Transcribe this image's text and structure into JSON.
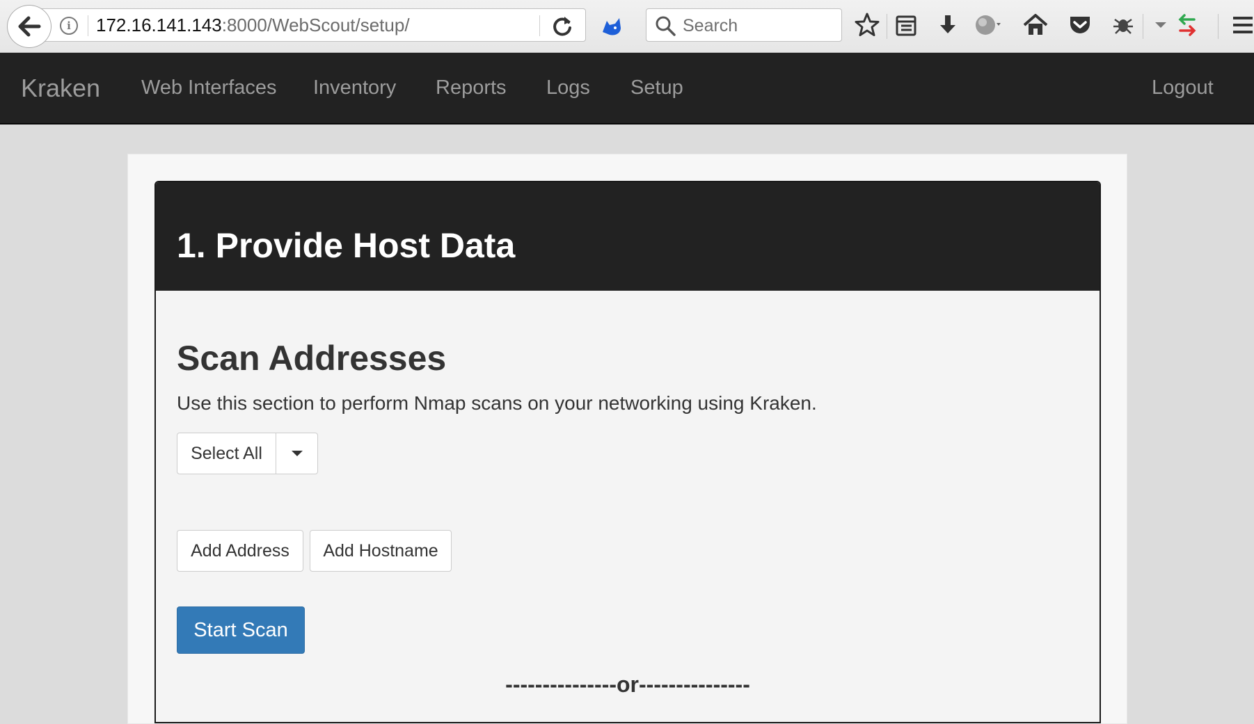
{
  "browser": {
    "url_host": "172.16.141.143",
    "url_path": ":8000/WebScout/setup/",
    "search_placeholder": "Search",
    "info_glyph": "i",
    "icons": [
      "back-arrow-icon",
      "info-icon",
      "reload-icon",
      "cat-extension-icon",
      "search-icon",
      "star-icon",
      "reading-list-icon",
      "download-icon",
      "globe-icon",
      "home-icon",
      "pocket-icon",
      "bug-extension-icon",
      "dropdown-arrow-icon",
      "sync-arrows-icon",
      "hamburger-menu-icon"
    ]
  },
  "navbar": {
    "brand": "Kraken",
    "items": [
      "Web Interfaces",
      "Inventory",
      "Reports",
      "Logs",
      "Setup"
    ],
    "logout": "Logout"
  },
  "panel": {
    "title": "1. Provide Host Data"
  },
  "section": {
    "title": "Scan Addresses",
    "description": "Use this section to perform Nmap scans on your networking using Kraken.",
    "select_all_label": "Select All",
    "add_address_label": "Add Address",
    "add_hostname_label": "Add Hostname",
    "start_scan_label": "Start Scan",
    "divider": "---------------or---------------"
  },
  "colors": {
    "navbar_bg": "#222222",
    "navbar_text": "#9d9d9d",
    "primary": "#337ab7",
    "page_bg": "#dcdcdc"
  }
}
